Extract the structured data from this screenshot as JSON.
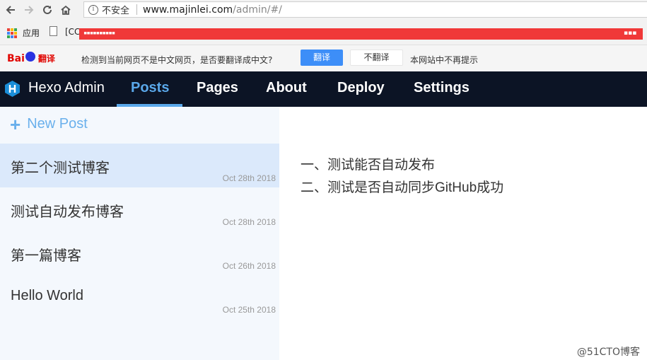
{
  "browser": {
    "security_label": "不安全",
    "url_host": "www.majinlei.com",
    "url_path": "/admin/#/",
    "bookmarks": {
      "apps_label": "应用",
      "item_label": "[CC"
    }
  },
  "translate_bar": {
    "brand": "Bai",
    "brand_suffix": "翻译",
    "message": "检测到当前网页不是中文网页，是否要翻译成中文?",
    "translate_button": "翻译",
    "no_translate_button": "不翻译",
    "never_label": "本网站中不再提示"
  },
  "app": {
    "brand": "Hexo Admin",
    "nav": [
      {
        "label": "Posts",
        "active": true
      },
      {
        "label": "Pages"
      },
      {
        "label": "About"
      },
      {
        "label": "Deploy"
      },
      {
        "label": "Settings"
      }
    ],
    "new_post_label": "New Post",
    "posts": [
      {
        "title": "第二个测试博客",
        "date": "Oct 28th 2018",
        "selected": true
      },
      {
        "title": "测试自动发布博客",
        "date": "Oct 28th 2018"
      },
      {
        "title": "第一篇博客",
        "date": "Oct 26th 2018"
      },
      {
        "title": "Hello World",
        "date": "Oct 25th 2018"
      }
    ],
    "preview_lines": [
      "一、测试能否自动发布",
      "二、测试是否自动同步GitHub成功"
    ]
  },
  "watermark": "@51CTO博客",
  "colors": {
    "header_bg": "#0c1425",
    "accent": "#5aa8ea",
    "sidebar_bg": "#f4f8fd",
    "selected_bg": "#dbe9fb",
    "redaction": "#f03838"
  }
}
